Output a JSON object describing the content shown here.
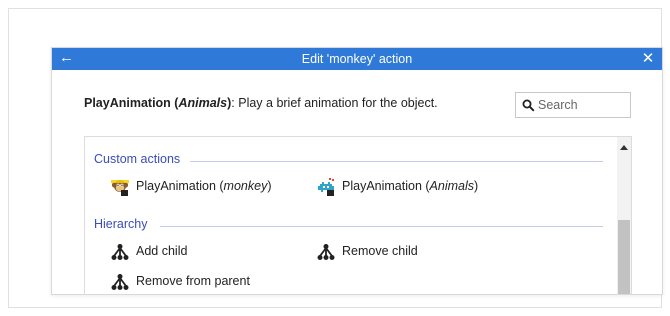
{
  "dialog": {
    "title": "Edit 'monkey' action",
    "back_icon": "arrow-left-icon",
    "close_icon": "close-icon",
    "title_bar_color": "#2f79d8"
  },
  "description": {
    "action_name": "PlayAnimation",
    "open_paren": " (",
    "category": "Animals",
    "close_paren": ")",
    "text": ": Play a brief animation for the object."
  },
  "search": {
    "placeholder": "Search",
    "icon": "search-icon"
  },
  "sections": {
    "custom_actions": {
      "label": "Custom actions",
      "items": [
        {
          "name": "PlayAnimation",
          "qualifier": "monkey",
          "icon": "monkey-icon"
        },
        {
          "name": "PlayAnimation",
          "qualifier": "Animals",
          "icon": "space-invader-icon"
        }
      ]
    },
    "hierarchy": {
      "label": "Hierarchy",
      "items": [
        {
          "label": "Add child",
          "icon": "hierarchy-icon"
        },
        {
          "label": "Remove child",
          "icon": "hierarchy-icon"
        },
        {
          "label": "Remove from parent",
          "icon": "hierarchy-icon"
        }
      ]
    }
  },
  "colors": {
    "section_header": "#3a4db8",
    "accent": "#2f79d8"
  }
}
